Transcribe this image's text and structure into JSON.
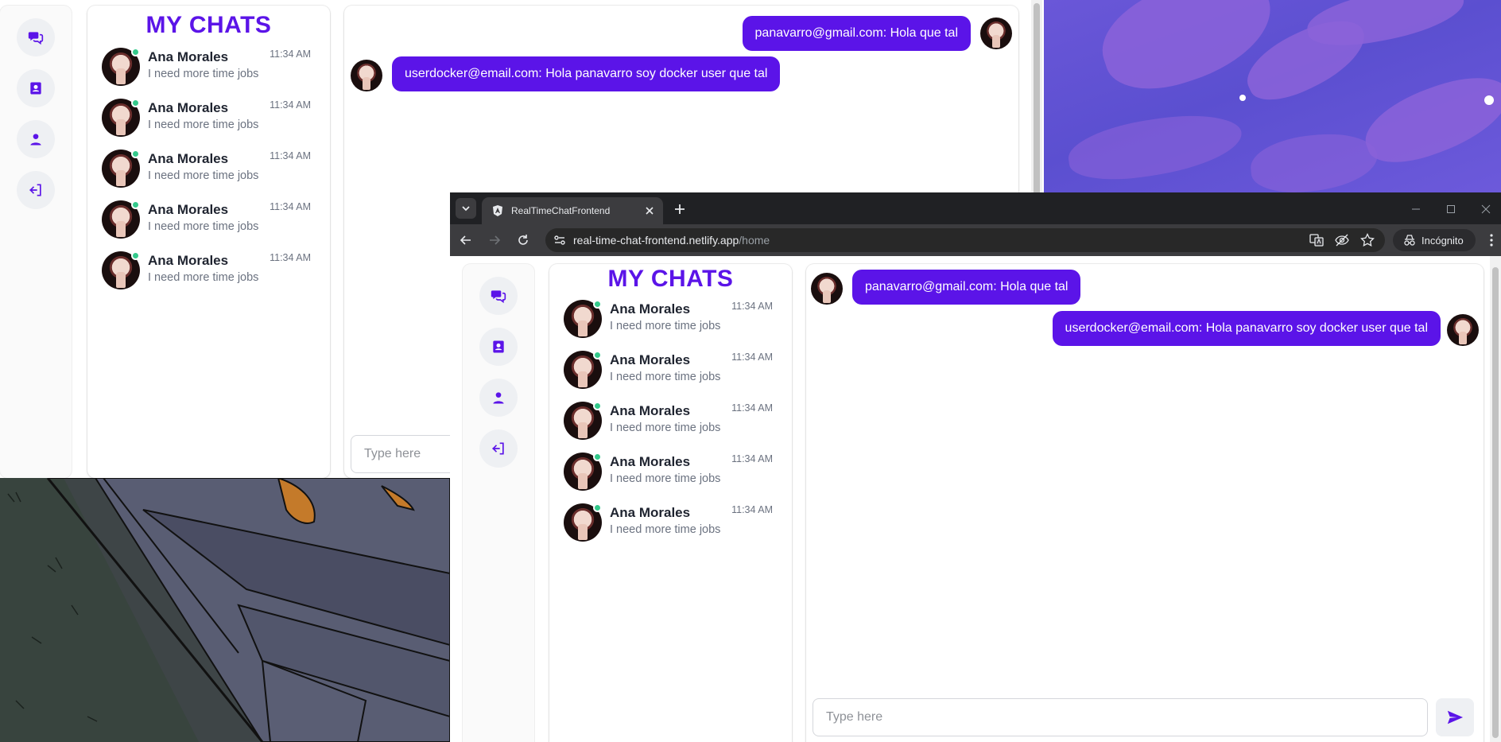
{
  "colors": {
    "accent": "#5b14e8",
    "online": "#34c98b",
    "browser_bg": "#202124",
    "toolbar_bg": "#3c3c3f"
  },
  "sidebar_icons": [
    "chats-icon",
    "contacts-icon",
    "user-icon",
    "logout-icon"
  ],
  "chat_list": {
    "title": "MY CHATS",
    "items": [
      {
        "name": "Ana Morales",
        "preview": "I need more time jobs",
        "time": "11:34 AM"
      },
      {
        "name": "Ana Morales",
        "preview": "I need more time jobs",
        "time": "11:34 AM"
      },
      {
        "name": "Ana Morales",
        "preview": "I need more time jobs",
        "time": "11:34 AM"
      },
      {
        "name": "Ana Morales",
        "preview": "I need more time jobs",
        "time": "11:34 AM"
      },
      {
        "name": "Ana Morales",
        "preview": "I need more time jobs",
        "time": "11:34 AM"
      }
    ]
  },
  "back_window": {
    "messages": [
      {
        "text": "panavarro@gmail.com: Hola que tal",
        "side": "right"
      },
      {
        "text": "userdocker@email.com: Hola panavarro soy docker user que tal",
        "side": "left"
      }
    ],
    "input_placeholder": "Type here"
  },
  "browser": {
    "tab_title": "RealTimeChatFrontend",
    "url_host": "real-time-chat-frontend.netlify.app",
    "url_path": "/home",
    "incognito_label": "Incógnito"
  },
  "front_window": {
    "messages": [
      {
        "text": "panavarro@gmail.com: Hola que tal",
        "side": "left"
      },
      {
        "text": "userdocker@email.com: Hola panavarro soy docker user que tal",
        "side": "right"
      }
    ],
    "input_placeholder": "Type here"
  }
}
